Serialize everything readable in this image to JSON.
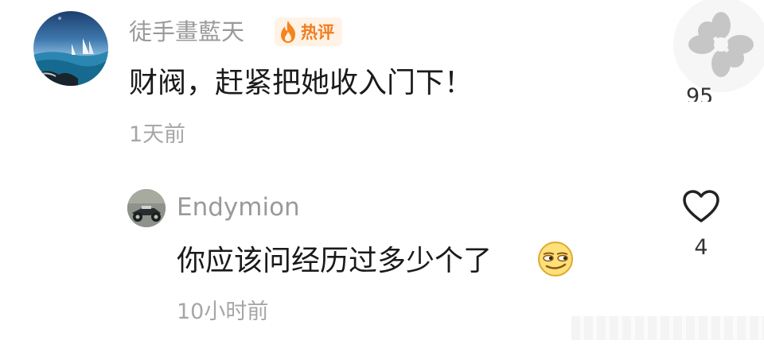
{
  "comment": {
    "username": "徒手畫藍天",
    "badge": "热评",
    "text": "财阀，赶紧把她收入门下！",
    "time": "1天前",
    "like_count": "95"
  },
  "reply": {
    "username": "Endymion",
    "text": "你应该问经历过多少个了",
    "time": "10小时前",
    "like_count": "4"
  },
  "icons": {
    "badge": "flame-icon",
    "like": "heart-outline-icon",
    "emoji": "smirk-emoji-icon",
    "watermark": "weibo-logo-icon"
  },
  "colors": {
    "hot_badge_text": "#f27c1d",
    "hot_badge_bg": "#fff3e6",
    "username": "#9a9a9a",
    "comment_text": "#1a1a1a",
    "timestamp": "#a6a6a6"
  }
}
